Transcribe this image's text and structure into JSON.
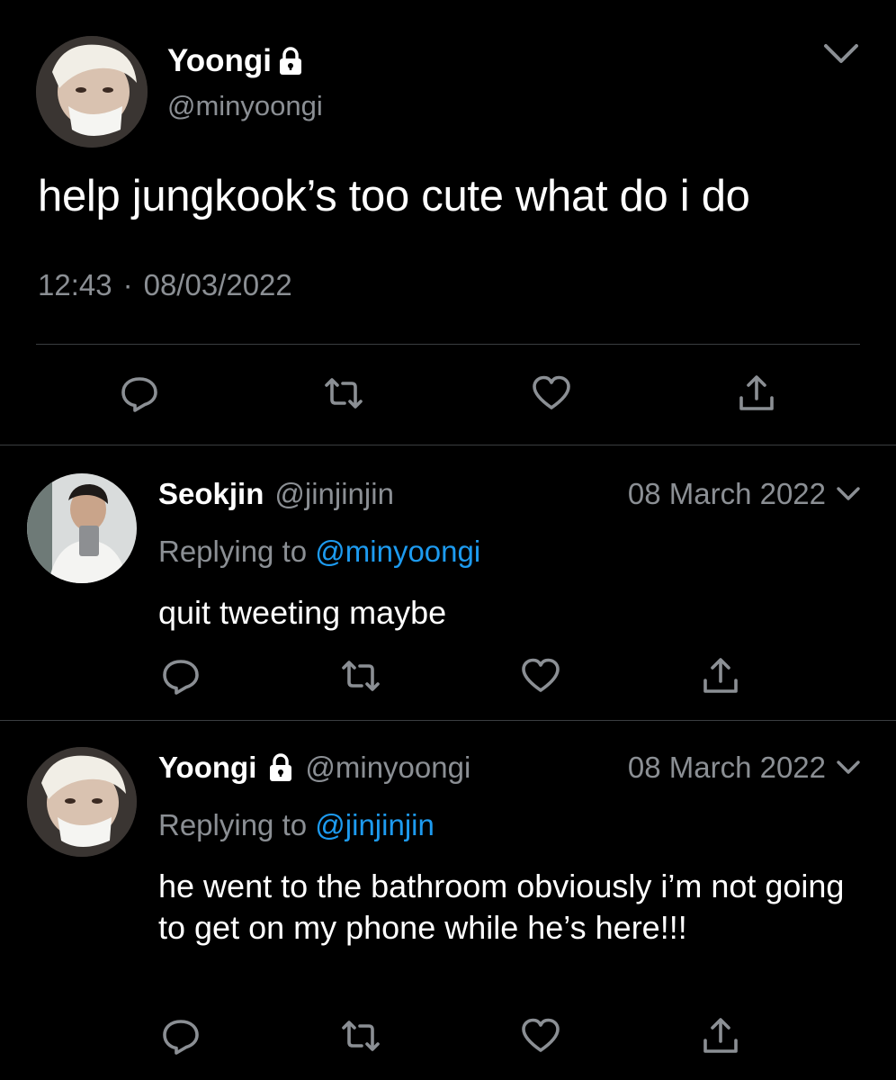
{
  "main_tweet": {
    "display_name": "Yoongi",
    "handle": "@minyoongi",
    "text": "help jungkook’s too cute what do i do",
    "time": "12:43",
    "separator": "·",
    "date": "08/03/2022",
    "protected_icon": "lock-icon",
    "menu_icon": "chevron-down-icon"
  },
  "actions": [
    {
      "name": "reply",
      "icon": "reply-icon"
    },
    {
      "name": "retweet",
      "icon": "retweet-icon"
    },
    {
      "name": "like",
      "icon": "heart-icon"
    },
    {
      "name": "share",
      "icon": "share-icon"
    }
  ],
  "replies": [
    {
      "display_name": "Seokjin",
      "handle": "@jinjinjin",
      "date": "08 March 2022",
      "replying_label": "Replying to",
      "replying_to": "@minyoongi",
      "text": "quit tweeting maybe"
    },
    {
      "display_name": "Yoongi",
      "handle": "@minyoongi",
      "date": "08 March 2022",
      "replying_label": "Replying to",
      "replying_to": "@jinjinjin",
      "text": "he went to the bathroom obviously i’m not going to get on my phone while he’s here!!!",
      "protected_icon": "lock-icon"
    }
  ],
  "colors": {
    "background": "#000000",
    "text": "#ffffff",
    "secondary_text": "#8b8f94",
    "mention": "#1d9bf0",
    "divider": "#3a3d40"
  }
}
